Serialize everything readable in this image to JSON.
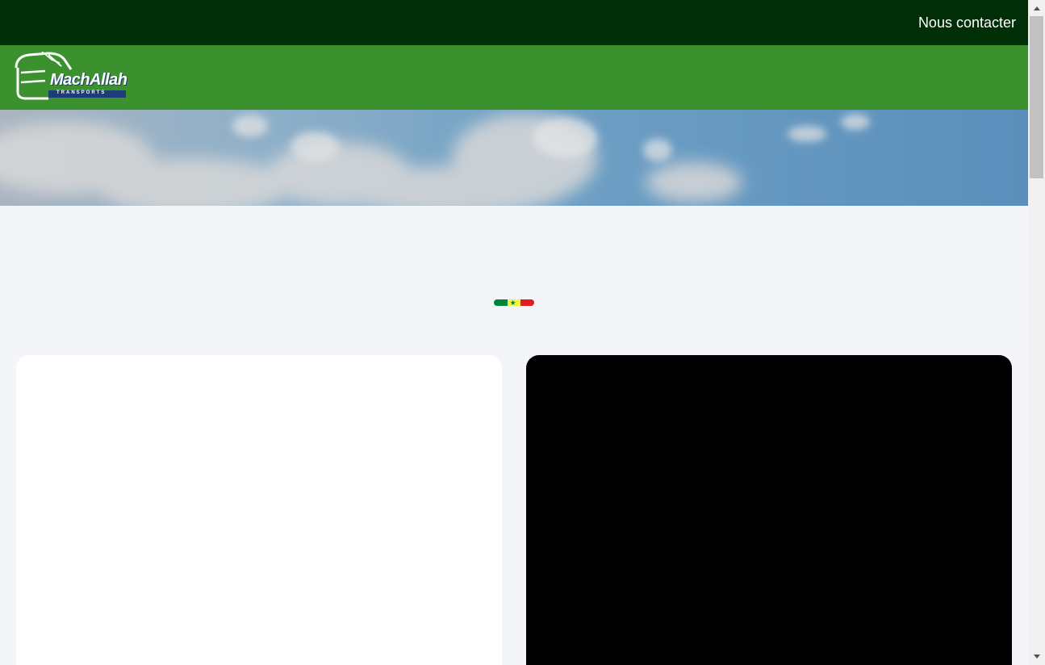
{
  "topbar": {
    "contact_label": "Nous contacter"
  },
  "header": {
    "logo_text": "MachAllah",
    "logo_subtext": "TRANSPORTS"
  },
  "flag_divider": {
    "colors": [
      "#00853f",
      "#fdef42",
      "#e31b23"
    ],
    "star_color": "#00853f"
  },
  "colors": {
    "topbar_bg": "#002e07",
    "header_bg": "#3a912e",
    "page_bg": "#f3f5f9",
    "card_left_bg": "#ffffff",
    "card_right_bg": "#000000"
  }
}
